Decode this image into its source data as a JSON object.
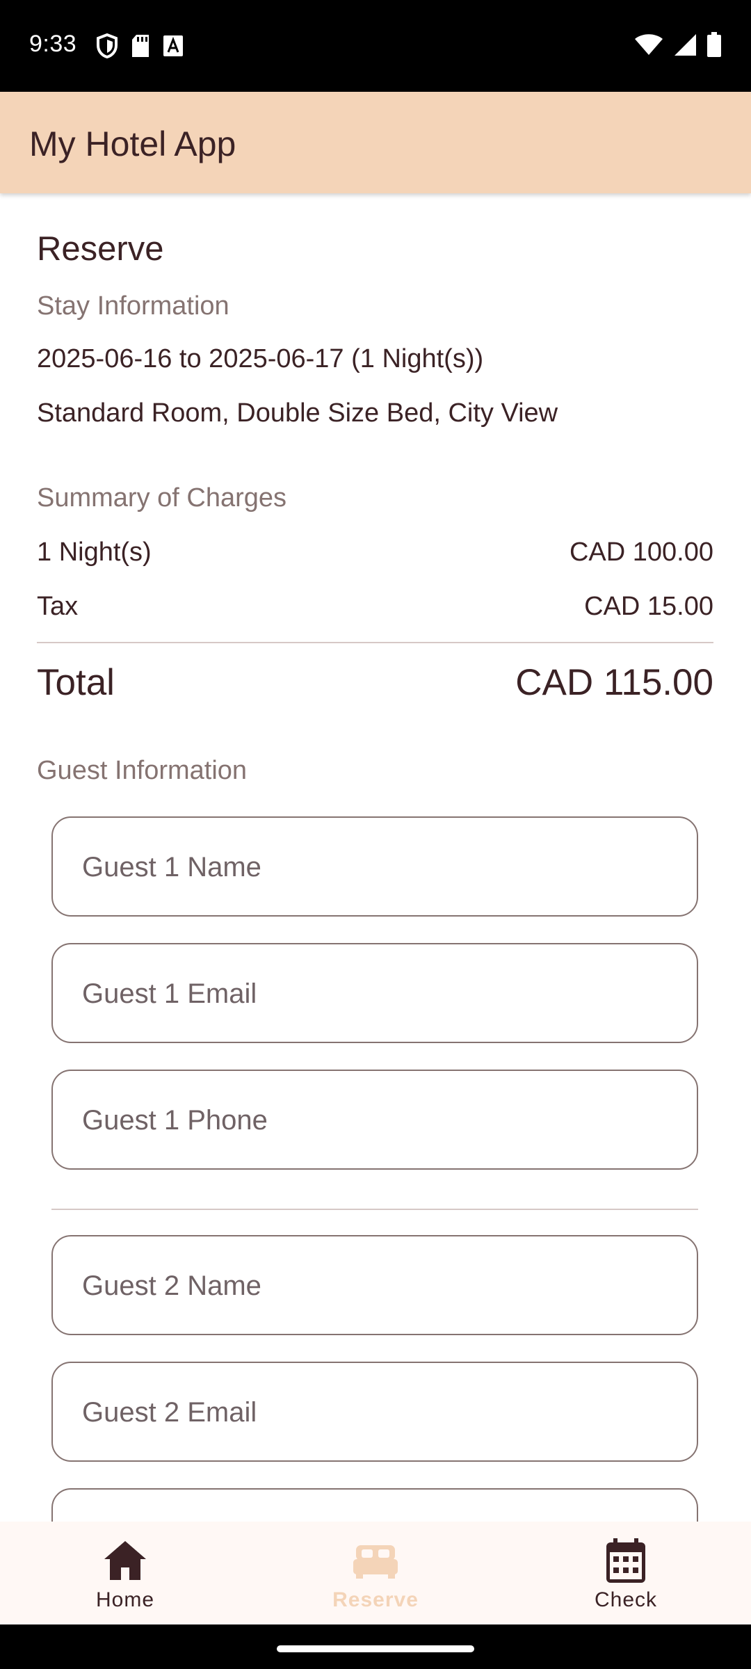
{
  "status_bar": {
    "time": "9:33",
    "left_icons": [
      "shield-icon",
      "sd-card-icon",
      "text-a-icon"
    ],
    "right_icons": [
      "wifi-icon",
      "cellular-signal-icon",
      "battery-icon"
    ]
  },
  "app_bar": {
    "title": "My Hotel App",
    "background": "#f4d4b8"
  },
  "page": {
    "heading": "Reserve"
  },
  "stay": {
    "label": "Stay Information",
    "dates": "2025-06-16 to 2025-06-17 (1 Night(s))",
    "room": "Standard Room, Double Size Bed, City View"
  },
  "charges": {
    "label": "Summary of Charges",
    "rows": [
      {
        "label": "1 Night(s)",
        "amount": "CAD 100.00"
      },
      {
        "label": "Tax",
        "amount": "CAD 15.00"
      }
    ],
    "total_label": "Total",
    "total_amount": "CAD 115.00"
  },
  "guests": {
    "label": "Guest Information",
    "fields": [
      {
        "placeholder": "Guest 1 Name",
        "value": ""
      },
      {
        "placeholder": "Guest 1 Email",
        "value": ""
      },
      {
        "placeholder": "Guest 1 Phone",
        "value": ""
      },
      {
        "placeholder": "Guest 2 Name",
        "value": ""
      },
      {
        "placeholder": "Guest 2 Email",
        "value": ""
      }
    ]
  },
  "bottom_nav": {
    "active_color": "#f4d4b8",
    "items": [
      {
        "label": "Home",
        "icon": "home-icon",
        "active": false
      },
      {
        "label": "Reserve",
        "icon": "bed-icon",
        "active": true
      },
      {
        "label": "Check",
        "icon": "calendar-icon",
        "active": false
      }
    ]
  }
}
